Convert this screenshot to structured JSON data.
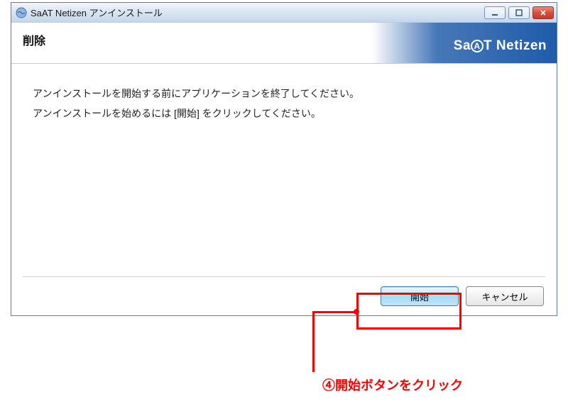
{
  "titlebar": {
    "title": "SaAT Netizen アンインストール"
  },
  "header": {
    "title": "削除",
    "brand_prefix": "Sa",
    "brand_a": "A",
    "brand_suffix": "T Netizen"
  },
  "content": {
    "line1": "アンインストールを開始する前にアプリケーションを終了してください。",
    "line2": "アンインストールを始めるには [開始] をクリックしてください。"
  },
  "footer": {
    "start": "開始",
    "cancel": "キャンセル"
  },
  "annotation": {
    "label": "④開始ボタンをクリック"
  }
}
